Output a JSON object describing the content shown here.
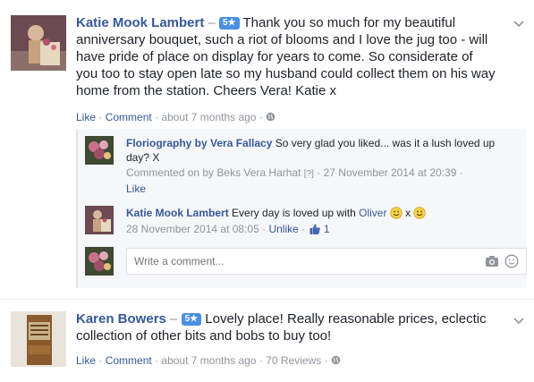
{
  "reviews": [
    {
      "author": "Katie Mook Lambert",
      "separator": "–",
      "rating_badge": "5★",
      "text": "Thank you so much for my beautiful anniversary bouquet, such a riot of blooms and I love the jug too - will have pride of place on display for years to come. So considerate of you too to stay open late so my husband could collect them on his way home from the station. Cheers Vera! Katie x",
      "actions": {
        "like": "Like",
        "comment": "Comment",
        "dot": "·",
        "time": "about 7 months ago"
      }
    },
    {
      "author": "Karen Bowers",
      "separator": "–",
      "rating_badge": "5★",
      "text": "Lovely place! Really reasonable prices, eclectic collection of other bits and bobs to buy too!",
      "actions": {
        "like": "Like",
        "comment": "Comment",
        "dot": "·",
        "time": "about 7 months ago",
        "reviews": "70 Reviews"
      }
    }
  ],
  "replies": [
    {
      "author": "Floriography by Vera Fallacy",
      "text": "So very glad you liked... was it a lush loved up day? X",
      "meta_prefix": "Commented on by Beks Vera Harhat",
      "meta_q": "[?]",
      "meta_date": "27 November 2014 at 20:39",
      "dot": "·",
      "like": "Like"
    },
    {
      "author": "Katie Mook Lambert",
      "text_before": "Every day is loved up with",
      "mention": "Oliver",
      "text_mid": "x",
      "date": "28 November 2014 at 08:05",
      "dot": "·",
      "unlike": "Unlike",
      "like_count": "1"
    }
  ],
  "comment_input": {
    "placeholder": "Write a comment..."
  },
  "colors": {
    "link": "#365899",
    "muted": "#90949c",
    "badge": "#4a90e2",
    "reply_bg": "#f6f7f9"
  },
  "icons": [
    "chevron-down-icon",
    "globe-icon",
    "smiley-icon",
    "thumbs-up-icon",
    "camera-icon",
    "emoji-icon"
  ]
}
